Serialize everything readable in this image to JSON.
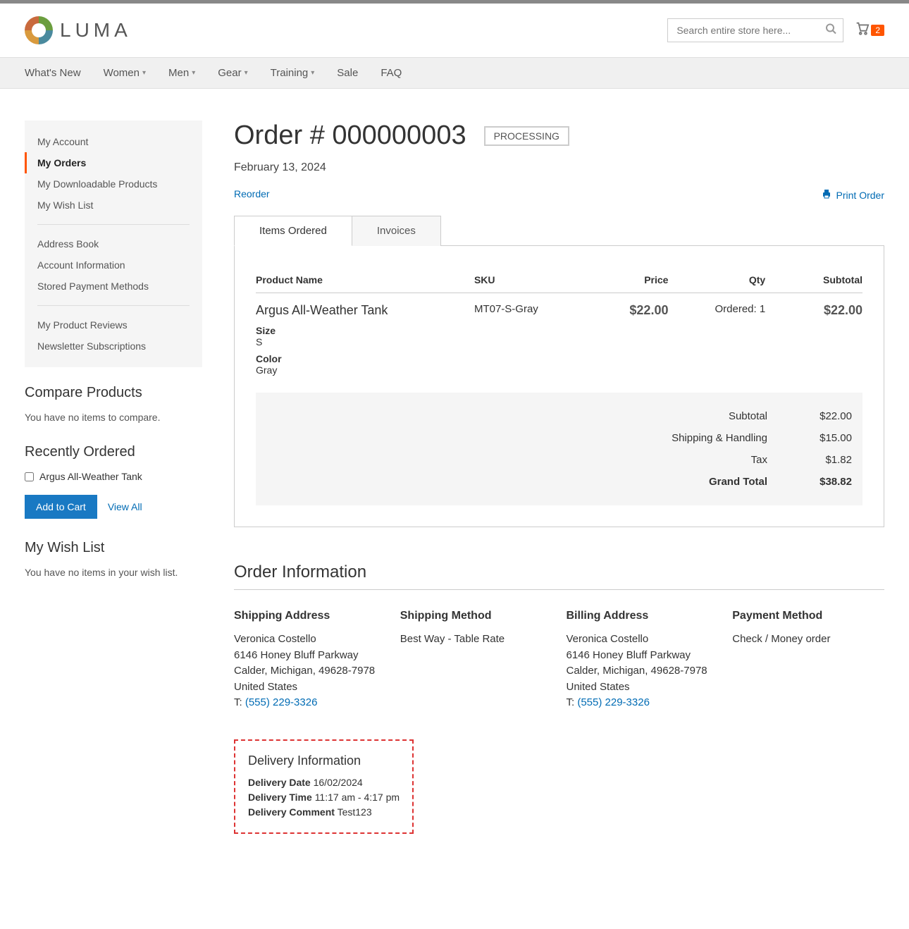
{
  "header": {
    "logo_text": "LUMA",
    "search_placeholder": "Search entire store here...",
    "cart_count": "2"
  },
  "nav": [
    {
      "label": "What's New",
      "dropdown": false
    },
    {
      "label": "Women",
      "dropdown": true
    },
    {
      "label": "Men",
      "dropdown": true
    },
    {
      "label": "Gear",
      "dropdown": true
    },
    {
      "label": "Training",
      "dropdown": true
    },
    {
      "label": "Sale",
      "dropdown": false
    },
    {
      "label": "FAQ",
      "dropdown": false
    }
  ],
  "sidebar_menu": {
    "g1": [
      "My Account",
      "My Orders",
      "My Downloadable Products",
      "My Wish List"
    ],
    "g2": [
      "Address Book",
      "Account Information",
      "Stored Payment Methods"
    ],
    "g3": [
      "My Product Reviews",
      "Newsletter Subscriptions"
    ],
    "active": "My Orders"
  },
  "compare": {
    "title": "Compare Products",
    "empty": "You have no items to compare."
  },
  "recent": {
    "title": "Recently Ordered",
    "item": "Argus All-Weather Tank",
    "add_btn": "Add to Cart",
    "view_all": "View All"
  },
  "wishlist": {
    "title": "My Wish List",
    "empty": "You have no items in your wish list."
  },
  "order": {
    "title": "Order # 000000003",
    "status": "PROCESSING",
    "date": "February 13, 2024",
    "reorder": "Reorder",
    "print": "Print Order",
    "tabs": {
      "items": "Items Ordered",
      "invoices": "Invoices"
    },
    "columns": {
      "name": "Product Name",
      "sku": "SKU",
      "price": "Price",
      "qty": "Qty",
      "subtotal": "Subtotal"
    },
    "line": {
      "name": "Argus All-Weather Tank",
      "sku": "MT07-S-Gray",
      "price": "$22.00",
      "qty": "Ordered: 1",
      "subtotal": "$22.00",
      "size_label": "Size",
      "size_val": "S",
      "color_label": "Color",
      "color_val": "Gray"
    },
    "totals": {
      "subtotal_l": "Subtotal",
      "subtotal_v": "$22.00",
      "shipping_l": "Shipping & Handling",
      "shipping_v": "$15.00",
      "tax_l": "Tax",
      "tax_v": "$1.82",
      "grand_l": "Grand Total",
      "grand_v": "$38.82"
    }
  },
  "info": {
    "title": "Order Information",
    "ship_addr": {
      "head": "Shipping Address",
      "name": "Veronica Costello",
      "street": "6146 Honey Bluff Parkway",
      "city": "Calder, Michigan, 49628-7978",
      "country": "United States",
      "tel_prefix": "T: ",
      "tel": "(555) 229-3326"
    },
    "ship_method": {
      "head": "Shipping Method",
      "val": "Best Way - Table Rate"
    },
    "bill_addr": {
      "head": "Billing Address",
      "name": "Veronica Costello",
      "street": "6146 Honey Bluff Parkway",
      "city": "Calder, Michigan, 49628-7978",
      "country": "United States",
      "tel_prefix": "T: ",
      "tel": "(555) 229-3326"
    },
    "pay_method": {
      "head": "Payment Method",
      "val": "Check / Money order"
    }
  },
  "delivery": {
    "title": "Delivery Information",
    "date_l": "Delivery Date",
    "date_v": "16/02/2024",
    "time_l": "Delivery Time",
    "time_v": "11:17 am - 4:17 pm",
    "comment_l": "Delivery Comment",
    "comment_v": "Test123"
  }
}
